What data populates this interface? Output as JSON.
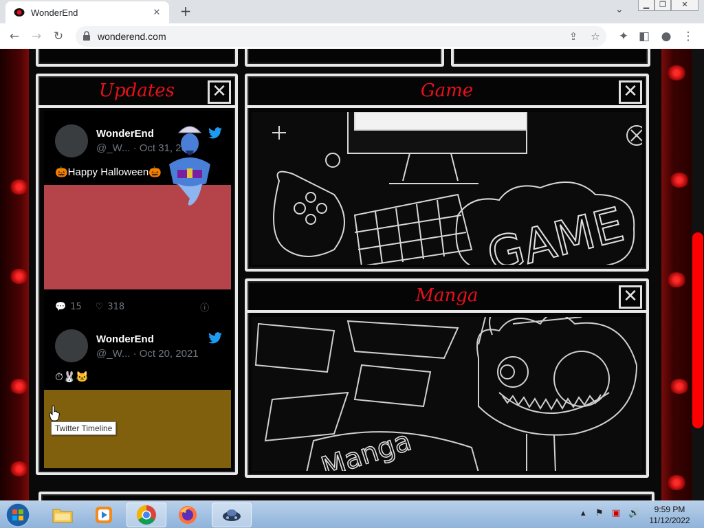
{
  "browser": {
    "tab_title": "WonderEnd",
    "url": "wonderend.com",
    "tab_close": "✕",
    "new_tab": "+",
    "tab_dropdown": "⌄"
  },
  "panels": {
    "updates": {
      "title": "Updates",
      "close": "✕"
    },
    "game": {
      "title": "Game",
      "close": "✕",
      "art_text": "GAME"
    },
    "manga": {
      "title": "Manga",
      "close": "✕",
      "art_text": "Manga"
    }
  },
  "tweets": [
    {
      "name": "WonderEnd",
      "handle": "@_W...",
      "date": "· Oct 31, 20",
      "text": "🎃Happy Halloween🎃",
      "media_color": "#b5434a",
      "replies": "15",
      "likes": "318"
    },
    {
      "name": "WonderEnd",
      "handle": "@_W...",
      "date": "· Oct 20, 2021",
      "text": "⏱🐰🐱",
      "media_color": "#80600c"
    }
  ],
  "tooltip": "Twitter Timeline",
  "taskbar": {
    "time": "9:59 PM",
    "date": "11/12/2022"
  },
  "colors": {
    "accent_red": "#e8101a",
    "chalk": "#e8e8e8",
    "twitter_blue": "#1d9bf0",
    "scroll_thumb": "#ff0000"
  }
}
